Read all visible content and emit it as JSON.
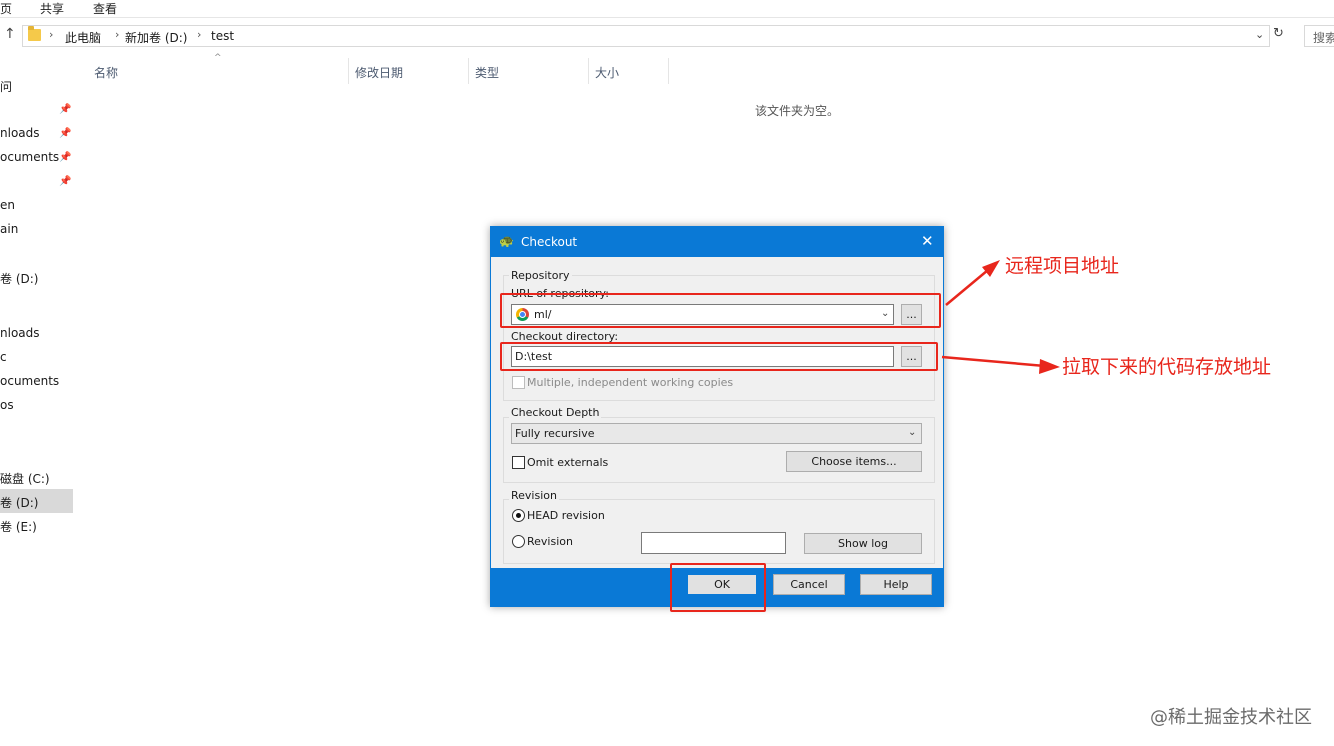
{
  "ribbon": {
    "tabs": [
      "页",
      "共享",
      "查看"
    ]
  },
  "address": {
    "breadcrumbs": [
      "此电脑",
      "新加卷 (D:)",
      "test"
    ],
    "search_placeholder": "搜索"
  },
  "nav": {
    "items": [
      "问",
      "nloads",
      "ocuments",
      "en",
      "ain",
      "卷 (D:)",
      "nloads",
      "c",
      "ocuments",
      "os",
      "磁盘 (C:)",
      "卷 (D:)",
      "卷 (E:)"
    ]
  },
  "columns": [
    "名称",
    "修改日期",
    "类型",
    "大小"
  ],
  "empty_message": "该文件夹为空。",
  "dialog": {
    "title": "Checkout",
    "repository_group": "Repository",
    "url_label": "URL of repository:",
    "url_value": "ml/",
    "checkout_dir_label": "Checkout directory:",
    "checkout_dir_value": "D:\\test",
    "browse_label": "...",
    "multiple_label": "Multiple, independent working copies",
    "depth_group": "Checkout Depth",
    "depth_value": "Fully recursive",
    "omit_externals": "Omit externals",
    "choose_items": "Choose items...",
    "revision_group": "Revision",
    "head_revision": "HEAD revision",
    "revision": "Revision",
    "revision_value": "",
    "show_log": "Show log",
    "ok": "OK",
    "cancel": "Cancel",
    "help": "Help",
    "close_glyph": "✕"
  },
  "annotations": {
    "remote": "远程项目地址",
    "local": "拉取下来的代码存放地址",
    "accent_color": "#e8261c"
  },
  "watermark": "@稀土掘金技术社区"
}
